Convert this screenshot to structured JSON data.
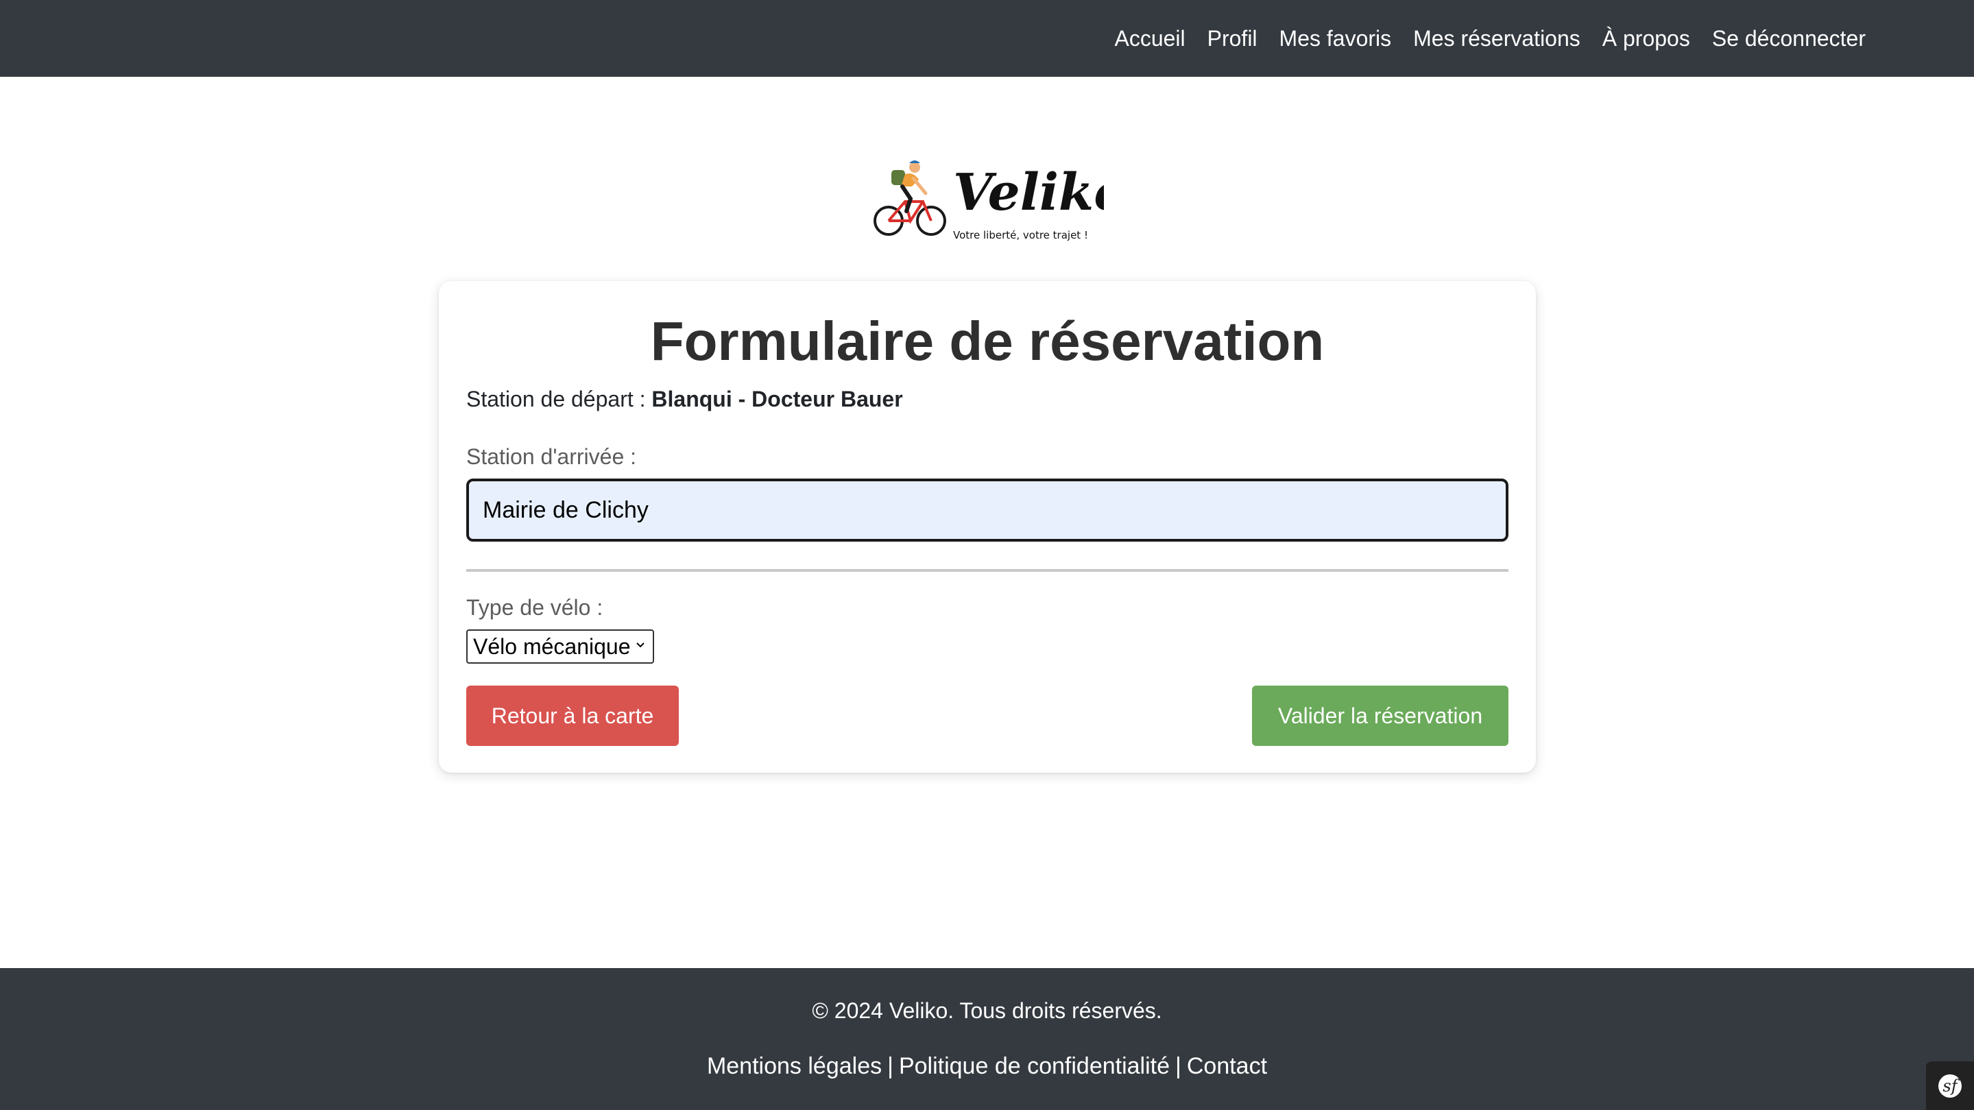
{
  "nav": {
    "links": [
      {
        "label": "Accueil"
      },
      {
        "label": "Profil"
      },
      {
        "label": "Mes favoris"
      },
      {
        "label": "Mes réservations"
      },
      {
        "label": "À propos"
      },
      {
        "label": "Se déconnecter"
      }
    ]
  },
  "logo": {
    "name": "Veliko",
    "tagline": "Votre liberté, votre trajet !"
  },
  "form": {
    "title": "Formulaire de réservation",
    "departure_label": "Station de départ :",
    "departure_value": "Blanqui - Docteur Bauer",
    "arrival_label": "Station d'arrivée :",
    "arrival_value": "Mairie de Clichy",
    "bike_label": "Type de vélo :",
    "bike_selected": "Vélo mécanique",
    "back_button": "Retour à la carte",
    "validate_button": "Valider la réservation"
  },
  "footer": {
    "copyright": "© 2024 Veliko. Tous droits réservés.",
    "links": [
      {
        "label": "Mentions légales"
      },
      {
        "label": "Politique de confidentialité"
      },
      {
        "label": "Contact"
      }
    ],
    "separator": "|"
  },
  "colors": {
    "navbar": "#343a40",
    "danger": "#d9534f",
    "success": "#6aaa5a",
    "input_bg": "#e8f0fe"
  }
}
